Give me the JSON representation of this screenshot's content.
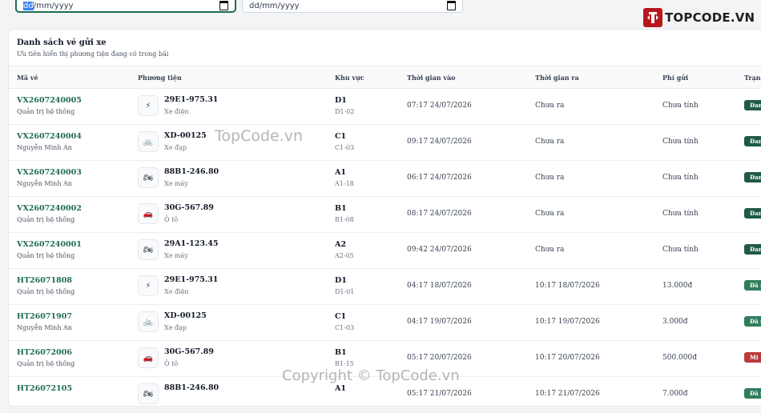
{
  "filters": {
    "date_from": "dd/mm/yyyy",
    "date_from_selected": "dd",
    "date_from_rest": "/mm/yyyy",
    "date_to": "dd/mm/yyyy"
  },
  "logo": {
    "text": "TOPCODE.VN"
  },
  "watermarks": {
    "top": "TopCode.vn",
    "bottom": "Copyright © TopCode.vn"
  },
  "card": {
    "title": "Danh sách vé gửi xe",
    "subtitle": "Ưu tiên hiển thị phương tiện đang có trong bãi"
  },
  "table": {
    "headers": [
      "Mã vé",
      "Phương tiện",
      "Khu vực",
      "Thời gian vào",
      "Thời gian ra",
      "Phí gửi",
      "Trạng"
    ],
    "rows": [
      {
        "code": "VX2607240005",
        "user": "Quản trị hệ thống",
        "icon": "bolt-icon",
        "glyph": "⚡",
        "plate": "29E1-975.31",
        "type": "Xe điện",
        "zone": "D1",
        "slot": "D1-02",
        "time_in": "07:17 24/07/2026",
        "time_out": "Chưa ra",
        "fee": "Chưa tính",
        "status": "Đan",
        "status_color": "#1e5a48"
      },
      {
        "code": "VX2607240004",
        "user": "Nguyễn Minh An",
        "icon": "bicycle-icon",
        "glyph": "🚲",
        "plate": "XD-00125",
        "type": "Xe đạp",
        "zone": "C1",
        "slot": "C1-03",
        "time_in": "09:17 24/07/2026",
        "time_out": "Chưa ra",
        "fee": "Chưa tính",
        "status": "Đan",
        "status_color": "#1e5a48"
      },
      {
        "code": "VX2607240003",
        "user": "Nguyễn Minh An",
        "icon": "motorbike-icon",
        "glyph": "🏍",
        "plate": "88B1-246.80",
        "type": "Xe máy",
        "zone": "A1",
        "slot": "A1-18",
        "time_in": "06:17 24/07/2026",
        "time_out": "Chưa ra",
        "fee": "Chưa tính",
        "status": "Đan",
        "status_color": "#1e5a48"
      },
      {
        "code": "VX2607240002",
        "user": "Quản trị hệ thống",
        "icon": "car-icon",
        "glyph": "🚗",
        "plate": "30G-567.89",
        "type": "Ô tô",
        "zone": "B1",
        "slot": "B1-08",
        "time_in": "08:17 24/07/2026",
        "time_out": "Chưa ra",
        "fee": "Chưa tính",
        "status": "Đan",
        "status_color": "#1e5a48"
      },
      {
        "code": "VX2607240001",
        "user": "Quản trị hệ thống",
        "icon": "motorbike-icon",
        "glyph": "🏍",
        "plate": "29A1-123.45",
        "type": "Xe máy",
        "zone": "A2",
        "slot": "A2-05",
        "time_in": "09:42 24/07/2026",
        "time_out": "Chưa ra",
        "fee": "Chưa tính",
        "status": "Đan",
        "status_color": "#1e5a48"
      },
      {
        "code": "HT26071808",
        "user": "Quản trị hệ thống",
        "icon": "bolt-icon",
        "glyph": "⚡",
        "plate": "29E1-975.31",
        "type": "Xe điện",
        "zone": "D1",
        "slot": "D1-01",
        "time_in": "04:17 18/07/2026",
        "time_out": "10:17 18/07/2026",
        "fee": "13.000đ",
        "status": "Đã r",
        "status_color": "#2e7d5b"
      },
      {
        "code": "HT26071907",
        "user": "Nguyễn Minh An",
        "icon": "bicycle-icon",
        "glyph": "🚲",
        "plate": "XD-00125",
        "type": "Xe đạp",
        "zone": "C1",
        "slot": "C1-03",
        "time_in": "04:17 19/07/2026",
        "time_out": "10:17 19/07/2026",
        "fee": "3.000đ",
        "status": "Đã r",
        "status_color": "#2e7d5b"
      },
      {
        "code": "HT26072006",
        "user": "Quản trị hệ thống",
        "icon": "car-icon",
        "glyph": "🚗",
        "plate": "30G-567.89",
        "type": "Ô tô",
        "zone": "B1",
        "slot": "B1-15",
        "time_in": "05:17 20/07/2026",
        "time_out": "10:17 20/07/2026",
        "fee": "500.000đ",
        "status": "Mi",
        "status_color": "#b83a3a"
      },
      {
        "code": "HT26072105",
        "user": "",
        "icon": "motorbike-icon",
        "glyph": "🏍",
        "plate": "88B1-246.80",
        "type": "",
        "zone": "A1",
        "slot": "",
        "time_in": "05:17 21/07/2026",
        "time_out": "10:17 21/07/2026",
        "fee": "7.000đ",
        "status": "Đã r",
        "status_color": "#2e7d5b"
      }
    ]
  }
}
